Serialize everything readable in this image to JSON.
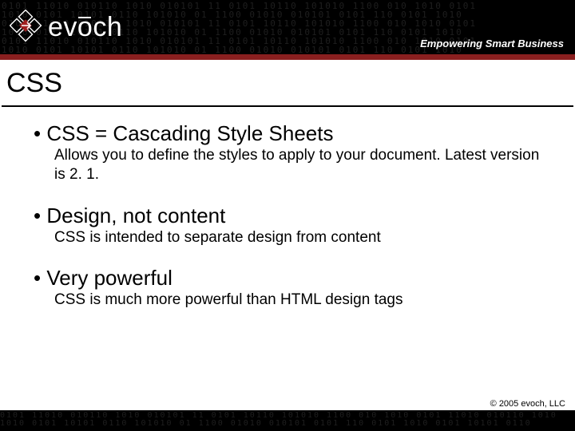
{
  "header": {
    "brand": "evōch",
    "tagline": "Empowering Smart Business"
  },
  "slide": {
    "title": "CSS",
    "bullets": [
      {
        "heading": "• CSS = Cascading Style Sheets",
        "body": "Allows you to define the styles to apply to your document. Latest version is 2. 1."
      },
      {
        "heading": "• Design, not content",
        "body": "CSS is intended to separate design from content"
      },
      {
        "heading": "• Very powerful",
        "body": "CSS is much more powerful than HTML design tags"
      }
    ]
  },
  "footer": {
    "copyright": "© 2005  evoch, LLC"
  }
}
